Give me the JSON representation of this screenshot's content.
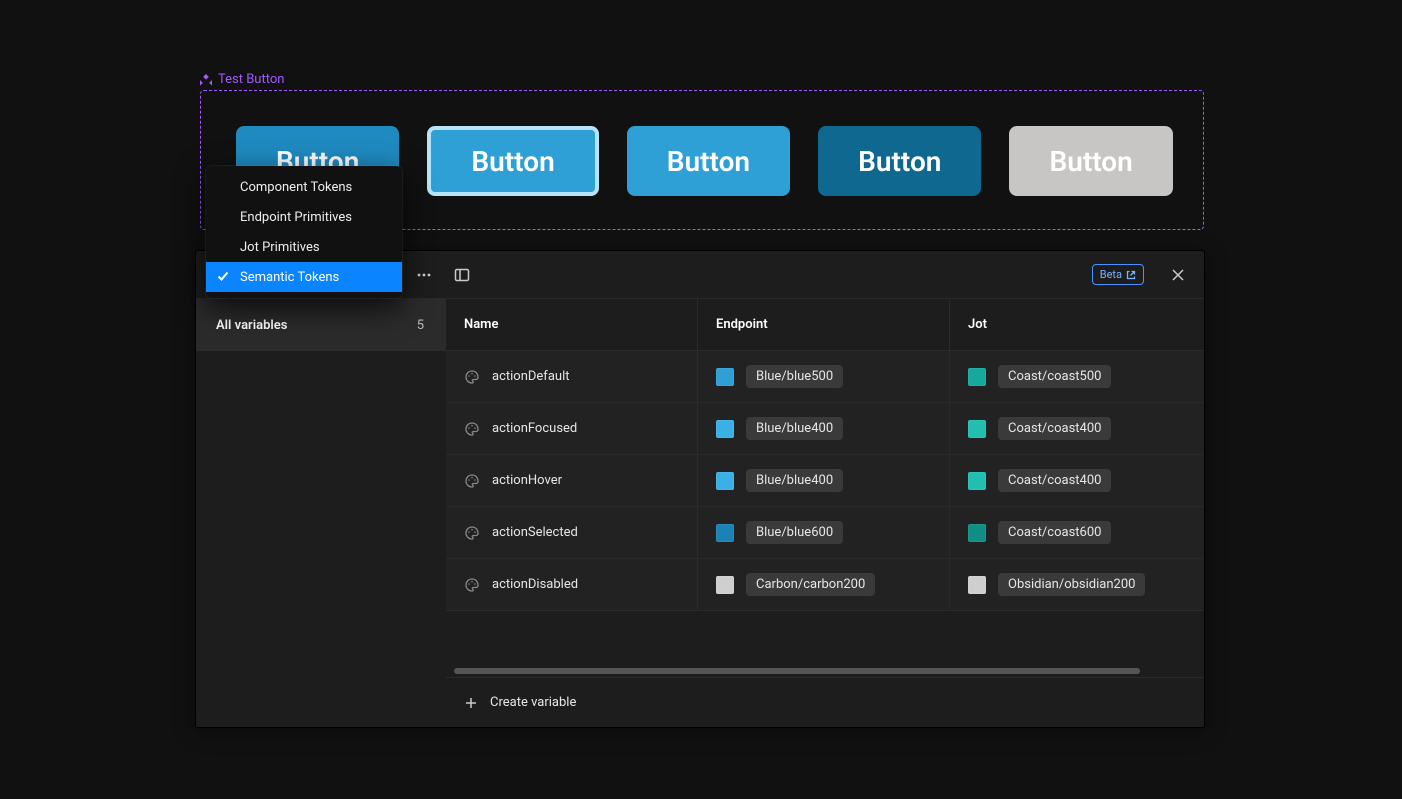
{
  "component": {
    "label": "Test Button",
    "buttons": [
      {
        "label": "Button",
        "state": "default"
      },
      {
        "label": "Button",
        "state": "focused"
      },
      {
        "label": "Button",
        "state": "hover"
      },
      {
        "label": "Button",
        "state": "selected"
      },
      {
        "label": "Button",
        "state": "disabled"
      }
    ]
  },
  "popover": {
    "items": [
      {
        "label": "Component Tokens",
        "selected": false
      },
      {
        "label": "Endpoint Primitives",
        "selected": false
      },
      {
        "label": "Jot Primitives",
        "selected": false
      },
      {
        "label": "Semantic Tokens",
        "selected": true
      }
    ]
  },
  "panel": {
    "beta_label": "Beta",
    "sidebar": {
      "all_label": "All variables",
      "count": "5"
    },
    "columns": {
      "name": "Name",
      "endpoint": "Endpoint",
      "jot": "Jot"
    },
    "footer": {
      "create_label": "Create variable"
    },
    "rows": [
      {
        "name": "actionDefault",
        "endpoint": {
          "label": "Blue/blue500",
          "swatch": "#2ea0d6"
        },
        "jot": {
          "label": "Coast/coast500",
          "swatch": "#16a89b"
        }
      },
      {
        "name": "actionFocused",
        "endpoint": {
          "label": "Blue/blue400",
          "swatch": "#3bb0e6"
        },
        "jot": {
          "label": "Coast/coast400",
          "swatch": "#22beb0"
        }
      },
      {
        "name": "actionHover",
        "endpoint": {
          "label": "Blue/blue400",
          "swatch": "#3bb0e6"
        },
        "jot": {
          "label": "Coast/coast400",
          "swatch": "#22beb0"
        }
      },
      {
        "name": "actionSelected",
        "endpoint": {
          "label": "Blue/blue600",
          "swatch": "#1a82b4"
        },
        "jot": {
          "label": "Coast/coast600",
          "swatch": "#108e83"
        }
      },
      {
        "name": "actionDisabled",
        "endpoint": {
          "label": "Carbon/carbon200",
          "swatch": "#cfcfcf"
        },
        "jot": {
          "label": "Obsidian/obsidian200",
          "swatch": "#cfcfcf"
        }
      }
    ]
  }
}
